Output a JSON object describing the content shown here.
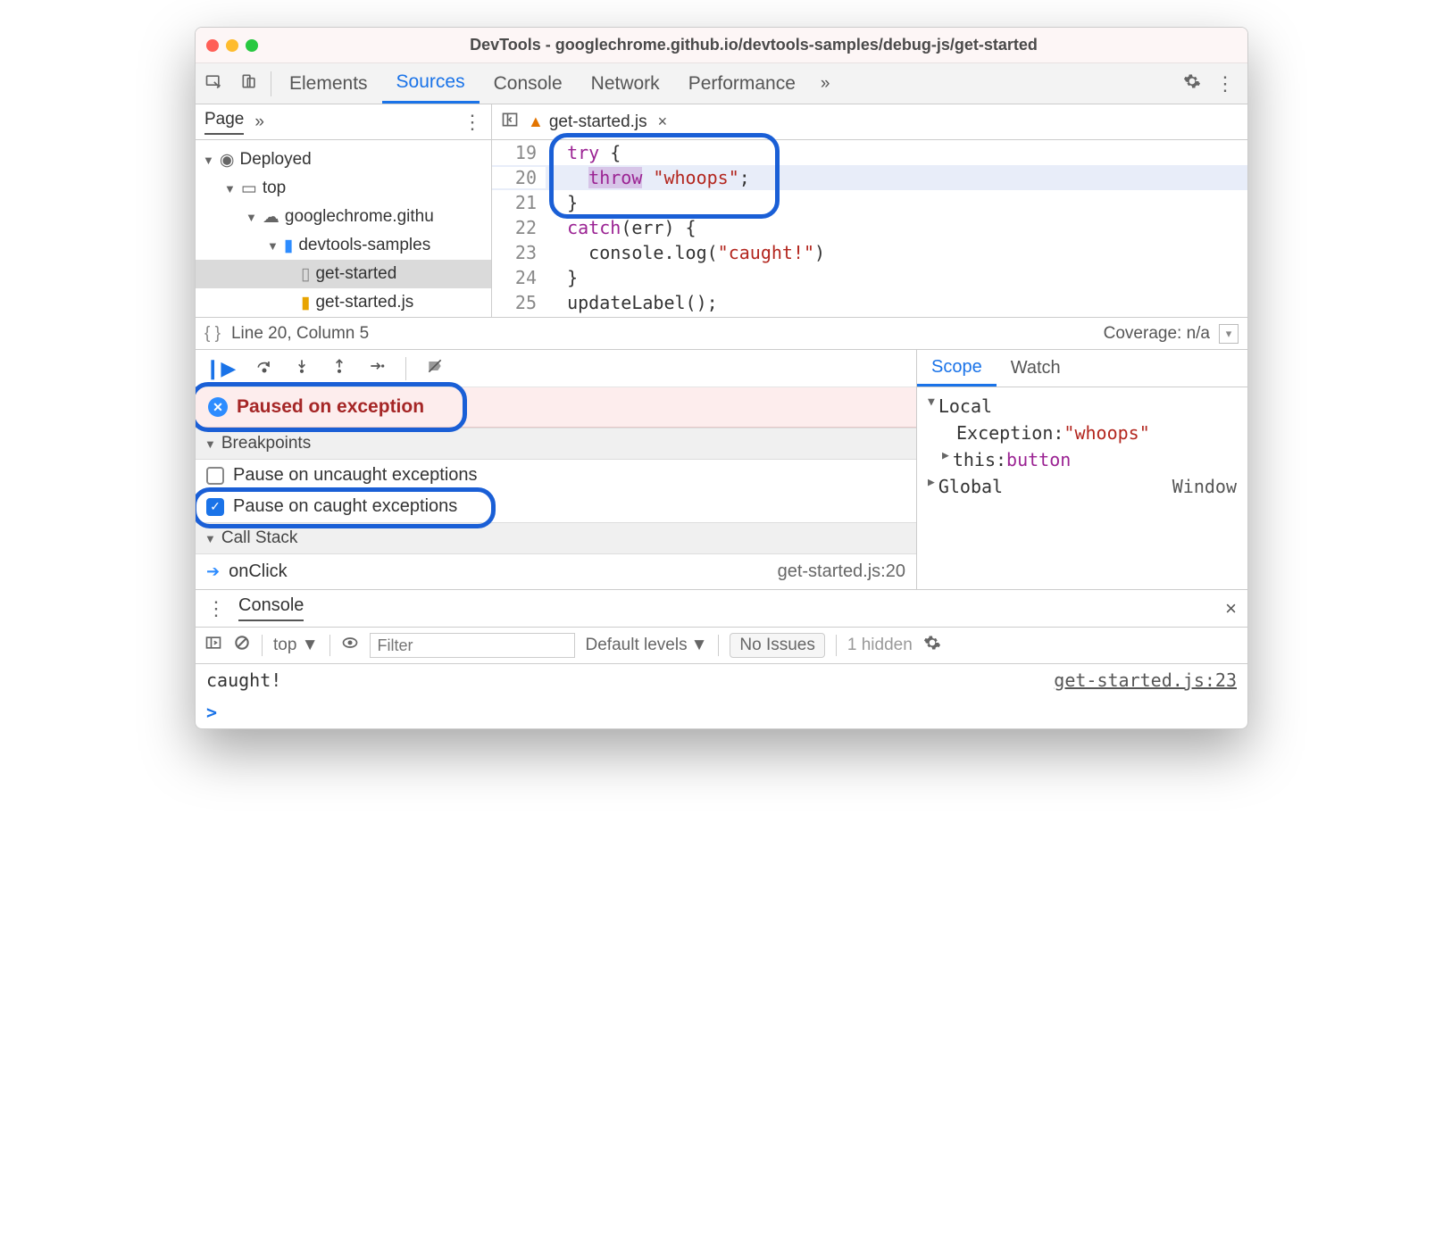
{
  "title": "DevTools - googlechrome.github.io/devtools-samples/debug-js/get-started",
  "tabs": {
    "t0": "Elements",
    "t1": "Sources",
    "t2": "Console",
    "t3": "Network",
    "t4": "Performance"
  },
  "sidebar": {
    "page": "Page",
    "deployed": "Deployed",
    "top": "top",
    "domain": "googlechrome.githu",
    "folder": "devtools-samples",
    "file1": "get-started",
    "file2": "get-started.js"
  },
  "file": {
    "name": "get-started.js"
  },
  "lines": {
    "n19": "19",
    "n20": "20",
    "n21": "21",
    "n22": "22",
    "n23": "23",
    "n24": "24",
    "n25": "25",
    "c19a": "try",
    "c19b": " {",
    "c20a": "throw",
    "c20b": " \"whoops\"",
    "c20c": ";",
    "c21": "}",
    "c22a": "catch",
    "c22b": "(err) {",
    "c23a": "console.log(",
    "c23b": "\"caught!\"",
    "c23c": ")",
    "c24": "}",
    "c25": "updateLabel();"
  },
  "status": {
    "pos": "Line 20, Column 5",
    "cov": "Coverage: n/a"
  },
  "paused": "Paused on exception",
  "bp": {
    "header": "Breakpoints",
    "uncaught": "Pause on uncaught exceptions",
    "caught": "Pause on caught exceptions"
  },
  "callstack": {
    "header": "Call Stack",
    "fn": "onClick",
    "loc": "get-started.js:20"
  },
  "scope": {
    "tab1": "Scope",
    "tab2": "Watch",
    "local": "Local",
    "exKey": "Exception: ",
    "exVal": "\"whoops\"",
    "thisKey": "this: ",
    "thisVal": "button",
    "global": "Global",
    "globalVal": "Window"
  },
  "console": {
    "drawer": "Console",
    "context": "top",
    "filter_ph": "Filter",
    "levels": "Default levels",
    "issues": "No Issues",
    "hidden": "1 hidden",
    "out": "caught!",
    "outloc": "get-started.js:23",
    "prompt": ">"
  }
}
